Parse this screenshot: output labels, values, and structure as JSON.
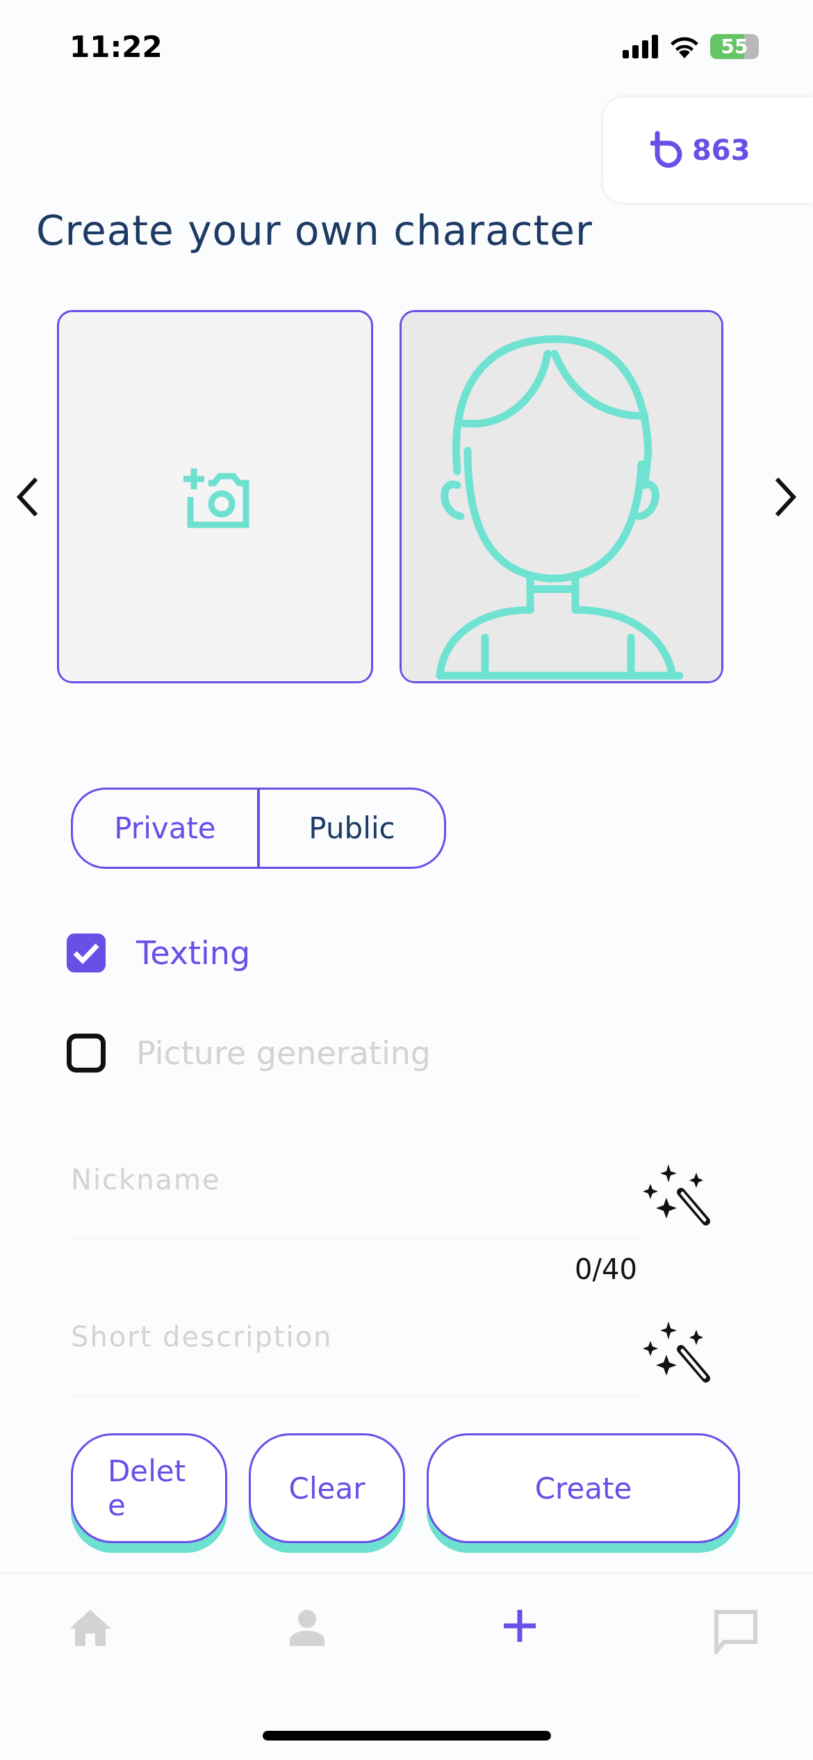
{
  "status_bar": {
    "time": "11:22",
    "battery": "55"
  },
  "balance": {
    "amount": "863"
  },
  "title": "Create your own character",
  "images": [
    {
      "kind": "upload"
    },
    {
      "kind": "picture"
    }
  ],
  "visibility": [
    {
      "label": "Private",
      "selected": true
    },
    {
      "label": "Public",
      "selected": false
    }
  ],
  "options": [
    {
      "label": "Texting",
      "checked": true
    },
    {
      "label": "Picture generating",
      "checked": false
    }
  ],
  "fields": [
    {
      "placeholder": "Nickname",
      "counter": "0/40"
    },
    {
      "placeholder": "Short description"
    }
  ],
  "actions": [
    {
      "label": "Delete"
    },
    {
      "label": "Clear"
    },
    {
      "label": "Create"
    }
  ],
  "nav": [
    {
      "kind": "home",
      "selected": false
    },
    {
      "kind": "profile",
      "selected": false
    },
    {
      "kind": "create",
      "selected": true
    },
    {
      "kind": "chat",
      "selected": false
    }
  ]
}
